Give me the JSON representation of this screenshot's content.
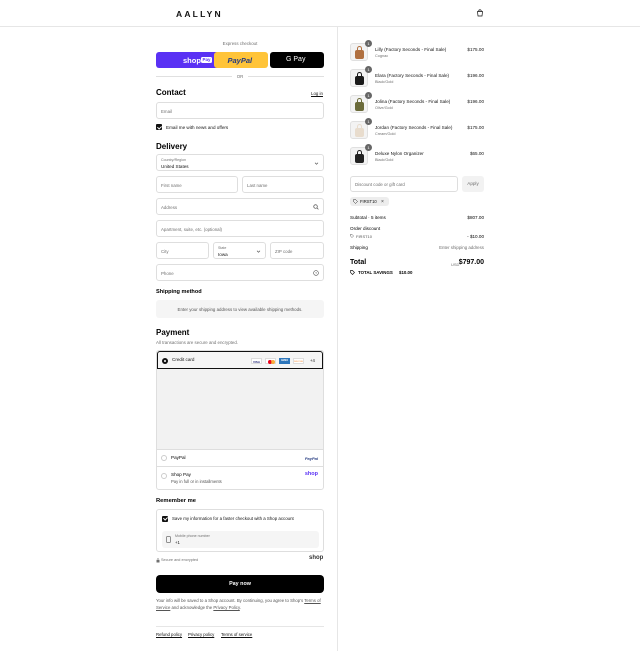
{
  "header": {
    "logo": "AALLYN"
  },
  "express": {
    "label": "Express checkout",
    "shoppay": "shop",
    "shoppay_pay": "Pay",
    "paypal": "PayPal",
    "gpay": "G Pay",
    "or": "OR"
  },
  "contact": {
    "title": "Contact",
    "login": "Log in",
    "email_placeholder": "Email",
    "news_label": "Email me with news and offers"
  },
  "delivery": {
    "title": "Delivery",
    "country_label": "Country/Region",
    "country_value": "United States",
    "first_name": "First name",
    "last_name": "Last name",
    "address": "Address",
    "apartment": "Apartment, suite, etc. (optional)",
    "city": "City",
    "state_label": "State",
    "state_value": "Iowa",
    "zip": "ZIP code",
    "phone": "Phone"
  },
  "shipping_method": {
    "title": "Shipping method",
    "notice": "Enter your shipping address to view available shipping methods."
  },
  "payment": {
    "title": "Payment",
    "subtitle": "All transactions are secure and encrypted.",
    "credit_card": "Credit card",
    "cards": [
      "VISA",
      "MC",
      "AMEX",
      "DISCOVER"
    ],
    "more_cards": "+4",
    "paypal": "PayPal",
    "paypal_logo": "PayPal",
    "shoppay": "Shop Pay",
    "shoppay_sub": "Pay in full or in installments",
    "shop_logo": "shop"
  },
  "remember": {
    "title": "Remember me",
    "save_label": "Save my information for a faster checkout with a Shop account",
    "phone_label": "Mobile phone number",
    "phone_value": "+1",
    "secure": "Secure and encrypted",
    "shop_logo": "shop"
  },
  "paynow": "Pay now",
  "legal": {
    "text1": "Your info will be saved to a Shop account. By continuing, you agree to Shop's",
    "terms": "Terms of Service",
    "text2": "and acknowledge the",
    "privacy": "Privacy Policy",
    "end": "."
  },
  "footer": {
    "refund": "Refund policy",
    "privacy": "Privacy policy",
    "terms": "Terms of service"
  },
  "cart": {
    "items": [
      {
        "name": "Lilly (Factory Seconds - Final Sale)",
        "variant": "Cognac",
        "price": "$175.00",
        "qty": "1",
        "color": "#b07040"
      },
      {
        "name": "Elara (Factory Seconds - Final Sale)",
        "variant": "Black/Gold",
        "price": "$196.00",
        "qty": "1",
        "color": "#1a1a1a"
      },
      {
        "name": "Jolina (Factory Seconds - Final Sale)",
        "variant": "Olive/Gold",
        "price": "$196.00",
        "qty": "1",
        "color": "#6b6b3a"
      },
      {
        "name": "Jordan (Factory Seconds - Final Sale)",
        "variant": "Cream/Gold",
        "price": "$175.00",
        "qty": "1",
        "color": "#e8dccd"
      },
      {
        "name": "Deluxe Nylon Organizer",
        "variant": "Black/Gold",
        "price": "$65.00",
        "qty": "1",
        "color": "#222222"
      }
    ],
    "discount_placeholder": "Discount code or gift card",
    "apply": "Apply",
    "code": "FIRST10",
    "subtotal_label": "Subtotal · 5 items",
    "subtotal": "$807.00",
    "order_discount": "Order discount",
    "discount_code": "FIRST10",
    "discount_amount": "- $10.00",
    "shipping_label": "Shipping",
    "shipping_value": "Enter shipping address",
    "total_label": "Total",
    "currency": "USD",
    "total": "$797.00",
    "savings_label": "TOTAL SAVINGS",
    "savings": "$10.00"
  },
  "colors": {
    "accent": "#5a31f4",
    "paypal": "#ffc439",
    "dark": "#000000"
  }
}
